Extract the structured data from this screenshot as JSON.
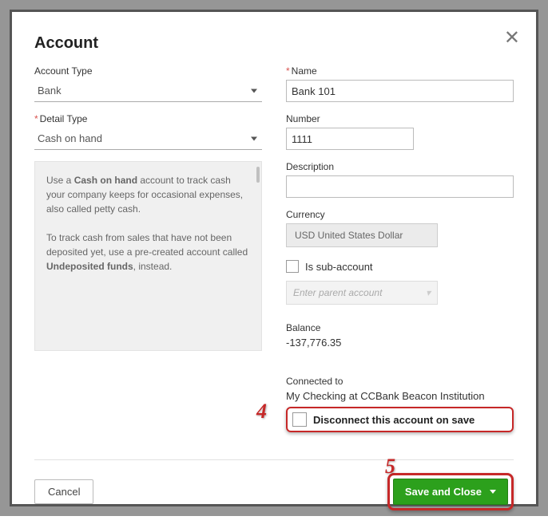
{
  "title": "Account",
  "left": {
    "account_type_label": "Account Type",
    "account_type_value": "Bank",
    "detail_type_label": "Detail Type",
    "detail_type_value": "Cash on hand",
    "help_html": "Use a <b>Cash on hand</b> account to track cash your company keeps for occasional expenses, also called petty cash.<br><br>To track cash from sales that have not been deposited yet, use a pre-created account called <b>Undeposited funds</b>, instead."
  },
  "right": {
    "name_label": "Name",
    "name_value": "Bank 101",
    "number_label": "Number",
    "number_value": "1111",
    "description_label": "Description",
    "description_value": "",
    "currency_label": "Currency",
    "currency_value": "USD United States Dollar",
    "sub_label": "Is sub-account",
    "parent_placeholder": "Enter parent account",
    "balance_label": "Balance",
    "balance_value": "-137,776.35",
    "connected_label": "Connected to",
    "connected_value": "My Checking at CCBank Beacon Institution",
    "disconnect_label": "Disconnect this account on save"
  },
  "footer": {
    "cancel_label": "Cancel",
    "save_label": "Save and Close"
  },
  "annotations": {
    "n4": "4",
    "n5": "5"
  }
}
